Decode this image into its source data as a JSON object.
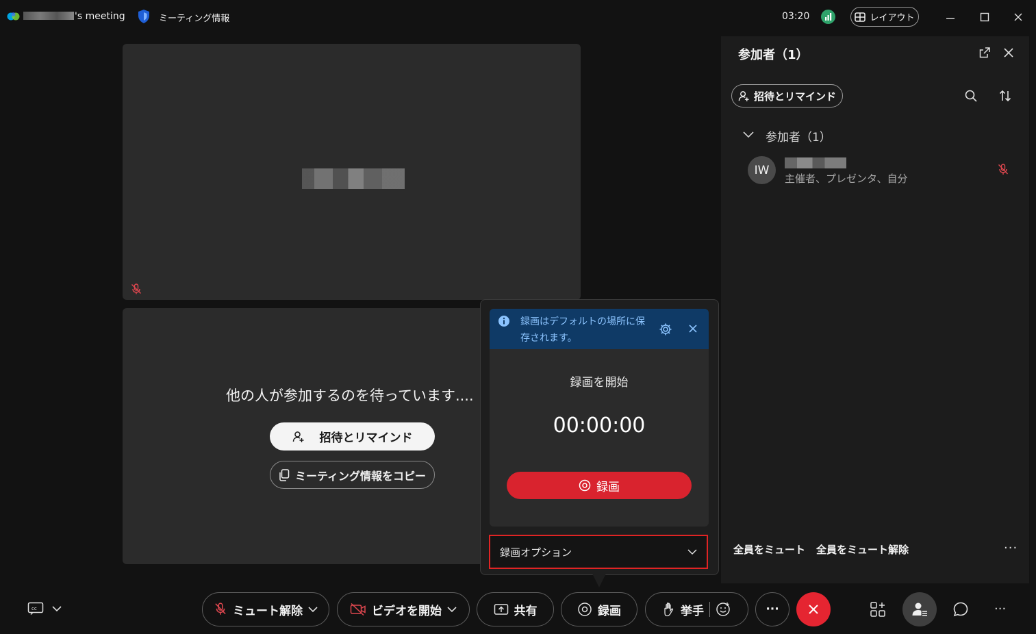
{
  "titlebar": {
    "meeting_title_suffix": "'s meeting",
    "meeting_info_label": "ミーティング情報",
    "timer": "03:20",
    "layout_label": "レイアウト"
  },
  "stage": {
    "waiting_text": "他の人が参加するのを待っています....",
    "invite_label": "招待とリマインド",
    "copy_info_label": "ミーティング情報をコピー"
  },
  "recording_popover": {
    "banner_text": "録画はデフォルトの場所に保存されます。",
    "start_label": "録画を開始",
    "elapsed": "00:00:00",
    "record_button_label": "録画",
    "options_label": "録画オプション"
  },
  "participants_panel": {
    "title": "参加者（1）",
    "invite_label": "招待とリマインド",
    "group_label": "参加者（1）",
    "participants": [
      {
        "initials": "IW",
        "roles": "主催者、プレゼンタ、自分",
        "muted": true
      }
    ],
    "mute_all_label": "全員をミュート",
    "unmute_all_label": "全員をミュート解除",
    "more_label": "···"
  },
  "toolbar": {
    "unmute_label": "ミュート解除",
    "start_video_label": "ビデオを開始",
    "share_label": "共有",
    "record_label": "録画",
    "raise_hand_label": "挙手",
    "more_label": "···"
  },
  "colors": {
    "background": "#121212",
    "end_call": "#e52531",
    "record_red": "#d9232e",
    "banner_blue": "#0f3a66",
    "muted_red": "#e0474f",
    "network_green": "#2fa36b"
  }
}
